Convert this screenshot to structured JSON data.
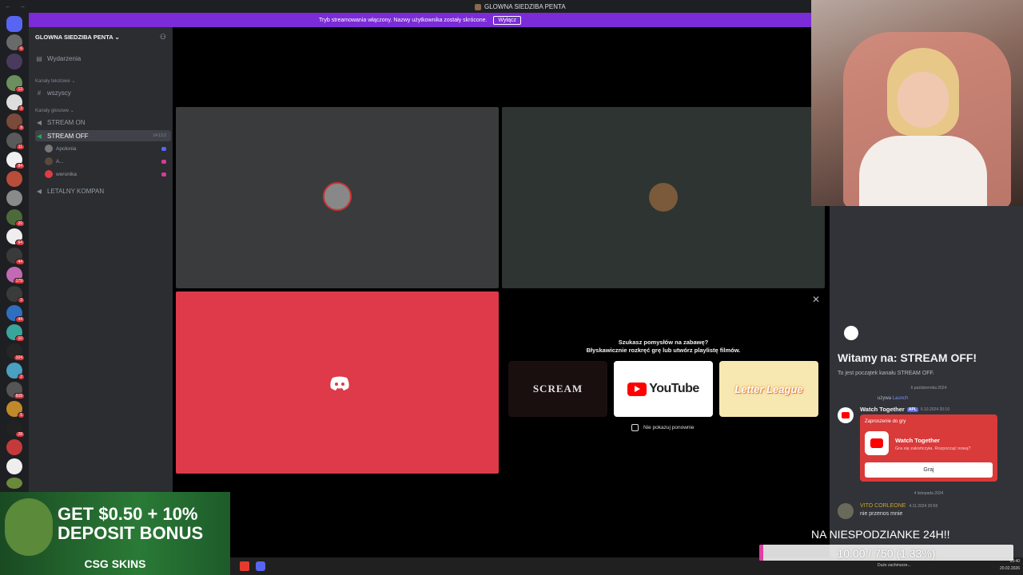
{
  "window": {
    "title": "GLOWNA SIEDZIBA PENTA",
    "nav_arrows": "← →"
  },
  "banner": {
    "text": "Tryb streamowania włączony. Nazwy użytkownika zostały skrócone.",
    "button": "Wyłącz"
  },
  "server_rail": {
    "badges": [
      "6",
      "13",
      "3",
      "9",
      "11",
      "84",
      "3",
      "20",
      "64",
      "44",
      "179",
      "3",
      "44",
      "10",
      "104",
      "2",
      "608",
      "5",
      "28"
    ]
  },
  "sidebar": {
    "server_name": "GLOWNA SIEDZIBA PENTA",
    "events": "Wydarzenia",
    "text_category": "Kanały tekstowe",
    "text_channels": [
      "wszyscy"
    ],
    "voice_category": "Kanały głosowe",
    "voice_channels": [
      {
        "name": "STREAM ON"
      },
      {
        "name": "STREAM OFF",
        "timer": "14:13:2"
      },
      {
        "name": "LETALNY KOMPAN"
      }
    ],
    "voice_users": [
      "Apolonia",
      "A...",
      "weronika"
    ]
  },
  "stage": {
    "prompt_line1": "Szukasz pomysłów na zabawę?",
    "prompt_line2": "Błyskawicznie rozkręć grę lub utwórz playlistę filmów.",
    "cards": [
      "SCREAM",
      "YouTube",
      "Letter League"
    ],
    "dont_show": "Nie pokazuj ponownie"
  },
  "chat": {
    "welcome_title": "Witamy na: STREAM OFF!",
    "welcome_sub": "To jest początek kanału STREAM OFF.",
    "date1": "6 października 2024",
    "uses_line": "używa",
    "uses_app": "Launch",
    "watch_name": "Watch Together",
    "watch_tag": "APL",
    "watch_time": "6.10.2024 20:10",
    "invite_label": "Zaproszenie do gry",
    "invite_title": "Watch Together",
    "invite_sub": "Gra się zakończyła. Rozpocząć nową?",
    "invite_btn": "Graj",
    "date2": "4 listopada 2024",
    "msg_user": "VITO CORLEONE",
    "msg_time": "4.11.2024 20:56",
    "msg_text": "nie przenos mnie"
  },
  "ad": {
    "line1": "GET $0.50 + 10%",
    "line2": "DEPOSIT BONUS",
    "brand": "CSG SKINS"
  },
  "goal": {
    "title": "NA NIESPODZIANKE 24H!!",
    "text": "10.00 / 750 (1.33%)",
    "progress": 0.0133
  },
  "taskbar": {
    "weather": "Duże zachmurze...",
    "time": "03:40",
    "date": "20.02.2026"
  },
  "colors": {
    "banner": "#7b2bd7",
    "red_tile": "#de3a49",
    "accent": "#5865f2"
  }
}
